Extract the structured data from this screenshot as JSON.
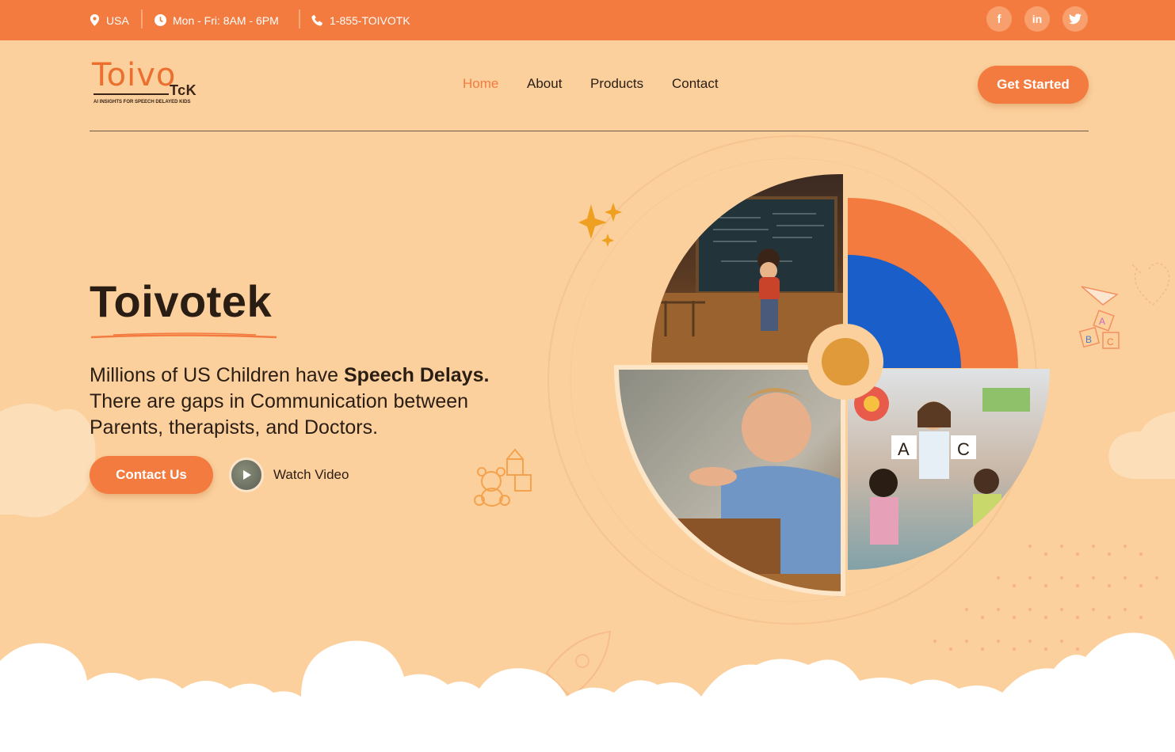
{
  "colors": {
    "accent": "#f47b3f",
    "background": "#fbd09d",
    "text": "#2a1d14",
    "blue": "#1a5fc9",
    "mustard": "#e09a3a"
  },
  "topbar": {
    "location": {
      "icon": "map-pin-icon",
      "label": "USA"
    },
    "hours": {
      "icon": "clock-icon",
      "label": "Mon - Fri: 8AM - 6PM"
    },
    "phone": {
      "icon": "phone-icon",
      "label": "1-855-TOIVOTK"
    },
    "social": [
      {
        "icon": "facebook-icon",
        "glyph": "f"
      },
      {
        "icon": "linkedin-icon",
        "glyph": "in"
      },
      {
        "icon": "twitter-icon",
        "glyph": "t"
      }
    ]
  },
  "logo": {
    "main": "Toivo",
    "sub": "TcK",
    "tagline": "AI INSIGHTS FOR SPEECH DELAYED KIDS"
  },
  "nav": {
    "items": [
      "Home",
      "About",
      "Products",
      "Contact"
    ],
    "active": "Home"
  },
  "header": {
    "cta": "Get Started"
  },
  "hero": {
    "title": "Toivotek",
    "text_pre": "Millions of US Children have ",
    "text_bold": "Speech Delays.",
    "text_post": " There are gaps in Communication between Parents, therapists, and Doctors.",
    "contact_button": "Contact Us",
    "watch_label": "Watch Video"
  },
  "photos": {
    "top_left": "child-at-chalkboard-photo",
    "bottom_left": "child-speaking-photo",
    "bottom_right": "teacher-with-children-photo"
  }
}
